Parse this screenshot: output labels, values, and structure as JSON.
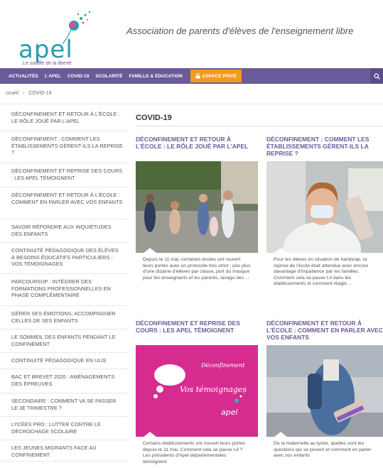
{
  "header": {
    "logo_word": "apel",
    "logo_tagline": "Le souffle de la liberté",
    "tagline": "Association de parents d'élèves de l'enseignement libre"
  },
  "nav": {
    "items": [
      "ACTUALITÉS",
      "L'APEL",
      "COVID-19",
      "SCOLARITÉ",
      "FAMILLE & ÉDUCATION"
    ],
    "special": "ESPACE PRIVÉ"
  },
  "breadcrumb": {
    "home": "ccueil",
    "current": "COVID-19"
  },
  "sidebar": {
    "items": [
      "DÉCONFINEMENT ET RETOUR À L'ÉCOLE : LE RÔLE JOUÉ PAR L'APEL",
      "DÉCONFINEMENT : COMMENT LES ÉTABLISSEMENTS GÈRENT-ILS LA REPRISE ?",
      "DÉCONFINEMENT ET REPRISE DES COURS : LES APEL TÉMOIGNENT",
      "DÉCONFINEMENT ET RETOUR À L'ÉCOLE : COMMENT EN PARLER AVEC VOS ENFANTS",
      "SAVOIR RÉPONDRE AUX INQUIÉTUDES DES ENFANTS",
      "CONTINUITÉ PÉDAGOGIQUE DES ÉLÈVES À BESOINS ÉDUCATIFS PARTICULIERS : VOS TÉMOIGNAGES",
      "PARCOURSUP : INTÉGRER DES FORMATIONS PROFESSIONNELLES EN PHASE COMPLÉMENTAIRE",
      "GÉRER SES ÉMOTIONS, ACCOMPAGNER CELLES DE SES ENFANTS",
      "LE SOMMEIL DES ENFANTS PENDANT LE CONFINEMENT",
      "CONTINUITÉ PÉDAGOGIQUE EN ULIS",
      "BAC ET BREVET 2020 : AMÉNAGEMENTS DES ÉPREUVES",
      "SECONDAIRE : COMMENT VA SE PASSER LE 3E TRIMESTRE ?",
      "LYCÉES PRO : LUTTER CONTRE LE DÉCROCHAGE SCOLAIRE",
      "LES JEUNES MIGRANTS FACE AU CONFINEMENT"
    ]
  },
  "main": {
    "title": "COVID-19",
    "cards": [
      {
        "title": "DÉCONFINEMENT ET RETOUR À L'ÉCOLE : LE RÔLE JOUÉ PAR L'APEL",
        "text": "Depuis le 11 mai, certaines écoles ont rouvert leurs portes avec un protocole très strict : pas plus d'une dizaine d'élèves par classe, port du masque pour les enseignants et les parents, lavage des ..."
      },
      {
        "title": "DÉCONFINEMENT : COMMENT LES ÉTABLISSEMENTS GÈRENT-ILS LA REPRISE ?",
        "text": "Pour les élèves en situation de handicap, la reprise de l'école était attendue avec encore davantage d'impatience par les familles. Comment cela se passe t-il dans les établissements et comment réagis ..."
      },
      {
        "title": "DÉCONFINEMENT ET REPRISE DES COURS : LES APEL TÉMOIGNENT",
        "text": "Certains établissements ont rouvert leurs portes depuis le 11 mai. Comment cela se passe t-il ? Les présidents d'Apel départementales témoignent",
        "image_title": "Déconfinement",
        "image_subtitle": "Vos témoignages",
        "image_brand": "apel"
      },
      {
        "title": "DÉCONFINEMENT ET RETOUR À L'ÉCOLE : COMMENT EN PARLER AVEC VOS ENFANTS",
        "text": "De la maternelle au lycée, quelles sont les questions qui se posent et comment en parler avec vos enfants"
      }
    ]
  },
  "colors": {
    "nav": "#6b5a9a",
    "accent": "#f39a1f",
    "card_title": "#6b5a9a",
    "brand": "#2a9bb0",
    "promo_pink": "#d62c8f"
  }
}
